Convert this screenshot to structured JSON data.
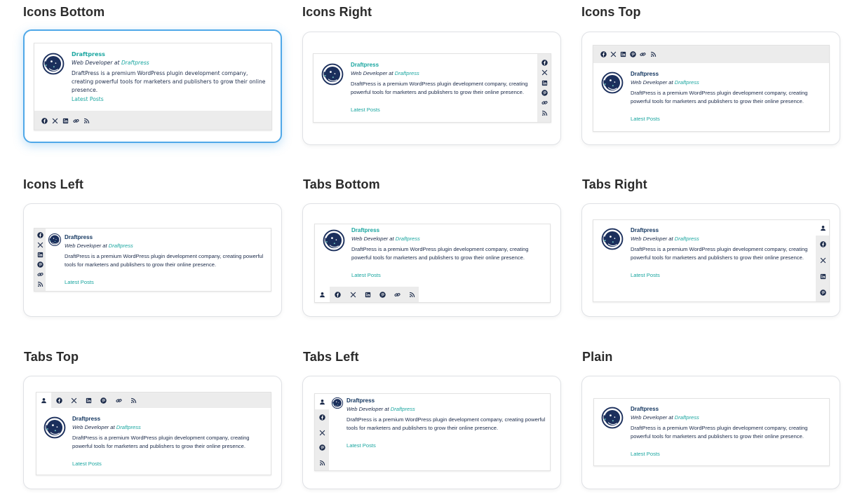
{
  "layouts": [
    {
      "id": "icons-bottom",
      "title": "Icons Bottom"
    },
    {
      "id": "icons-right",
      "title": "Icons Right"
    },
    {
      "id": "icons-top",
      "title": "Icons Top"
    },
    {
      "id": "icons-left",
      "title": "Icons Left"
    },
    {
      "id": "tabs-bottom",
      "title": "Tabs Bottom"
    },
    {
      "id": "tabs-right",
      "title": "Tabs Right"
    },
    {
      "id": "tabs-top",
      "title": "Tabs Top"
    },
    {
      "id": "tabs-left",
      "title": "Tabs Left"
    },
    {
      "id": "plain",
      "title": "Plain"
    }
  ],
  "author": {
    "name_teal": "Draftpress",
    "name": "Draftpress",
    "job_prefix": "Web Developer at ",
    "company": "Draftpress",
    "bio": "DraftPress is a premium WordPress plugin development company, creating powerful tools for marketers and publishers to grow their online presence.",
    "link": "Latest Posts"
  },
  "icons": {
    "icon_set_a": [
      "facebook-icon",
      "x-icon",
      "linkedin-icon",
      "link-icon",
      "rss-icon"
    ],
    "icon_set_b": [
      "facebook-icon",
      "x-icon",
      "linkedin-icon",
      "pinterest-icon",
      "link-icon",
      "rss-icon"
    ],
    "tab_set": [
      "user-icon",
      "facebook-icon",
      "x-icon",
      "linkedin-icon",
      "pinterest-icon",
      "link-icon",
      "rss-icon"
    ]
  },
  "colors": {
    "accent_teal": "#1aa6a0",
    "text_navy": "#1c2b4a",
    "selected_border": "#4fa8e8"
  }
}
